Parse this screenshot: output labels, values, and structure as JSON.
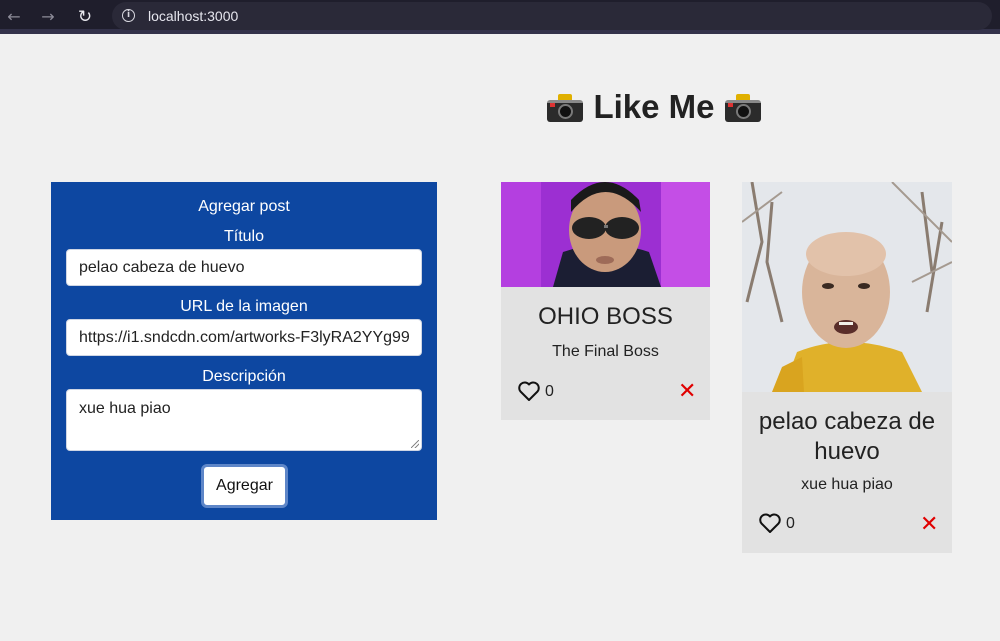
{
  "browser": {
    "url": "localhost:3000",
    "back_icon": "arrow-left-icon",
    "forward_icon": "arrow-right-icon",
    "reload_icon": "reload-icon",
    "info_icon": "info-icon"
  },
  "page": {
    "title": "Like Me",
    "title_icon": "camera-icon"
  },
  "form": {
    "heading": "Agregar post",
    "title_label": "Título",
    "title_value": "pelao cabeza de huevo",
    "url_label": "URL de la imagen",
    "url_value": "https://i1.sndcdn.com/artworks-F3lyRA2YYg99",
    "description_label": "Descripción",
    "description_value": "xue hua piao",
    "submit_label": "Agregar",
    "panel_color": "#0d47a1"
  },
  "posts": [
    {
      "title": "OHIO BOSS",
      "description": "The Final Boss",
      "likes": "0",
      "like_icon": "heart-outline-icon",
      "delete_icon": "close-icon"
    },
    {
      "title": "pelao cabeza de huevo",
      "description": "xue hua piao",
      "likes": "0",
      "like_icon": "heart-outline-icon",
      "delete_icon": "close-icon"
    }
  ],
  "colors": {
    "delete": "#e00000",
    "card_background": "#e2e2e2"
  }
}
